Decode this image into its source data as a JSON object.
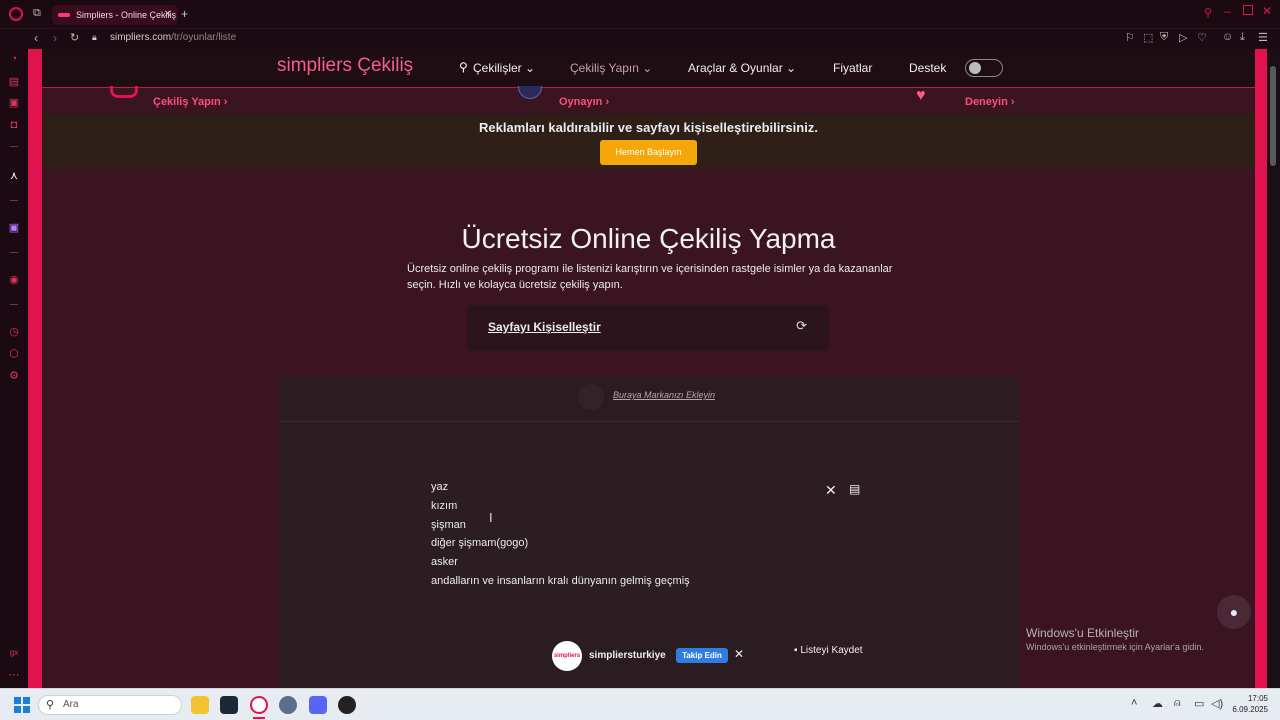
{
  "browser": {
    "tab_title": "Simpliers - Online Çekiliş",
    "url_host": "simpliers.com",
    "url_path": "/tr/oyunlar/liste"
  },
  "site_nav": {
    "logo_main": "simpliers",
    "logo_sub": " Çekiliş",
    "items": [
      {
        "label": "Çekilişler ⌄"
      },
      {
        "label": "Çekiliş Yapın ⌄"
      },
      {
        "label": "Araçlar & Oyunlar ⌄"
      },
      {
        "label": "Fiyatlar"
      },
      {
        "label": "Destek"
      }
    ]
  },
  "promo_links": [
    "Çekiliş Yapın ›",
    "Oynayın ›",
    "Deneyin ›"
  ],
  "ad_banner": {
    "text": "Reklamları kaldırabilir ve sayfayı kişiselleştirebilirsiniz.",
    "button": "Hemen Başlayın"
  },
  "hero": {
    "title": "Ücretsiz Online Çekiliş Yapma",
    "description": "Ücretsiz online çekiliş programı ile listenizi karıştırın ve içerisinden rastgele isimler ya da kazananlar seçin. Hızlı ve kolayca ücretsiz çekiliş yapın."
  },
  "customize": {
    "label": "Sayfayı Kişiselleştir"
  },
  "brand_link": "Buraya Markanızı Ekleyin",
  "editor_lines": [
    "yaz",
    "kızım",
    "şişman",
    "diğer şişmam(gogo)",
    "asker",
    "andalların ve insanların kralı dünyanın gelmiş geçmiş"
  ],
  "follow_bar": {
    "logo": "simpliers",
    "name": "simpliersturkiye",
    "button": "Takip Edin",
    "close": "✕"
  },
  "save_list": "Listeyi Kaydet",
  "windows_activation": {
    "title": "Windows'u Etkinleştir",
    "subtitle": "Windows'u etkinleştirmek için Ayarlar'a gidin."
  },
  "taskbar": {
    "search_placeholder": "Ara",
    "time": "17:05",
    "date": "6.09.2025"
  }
}
